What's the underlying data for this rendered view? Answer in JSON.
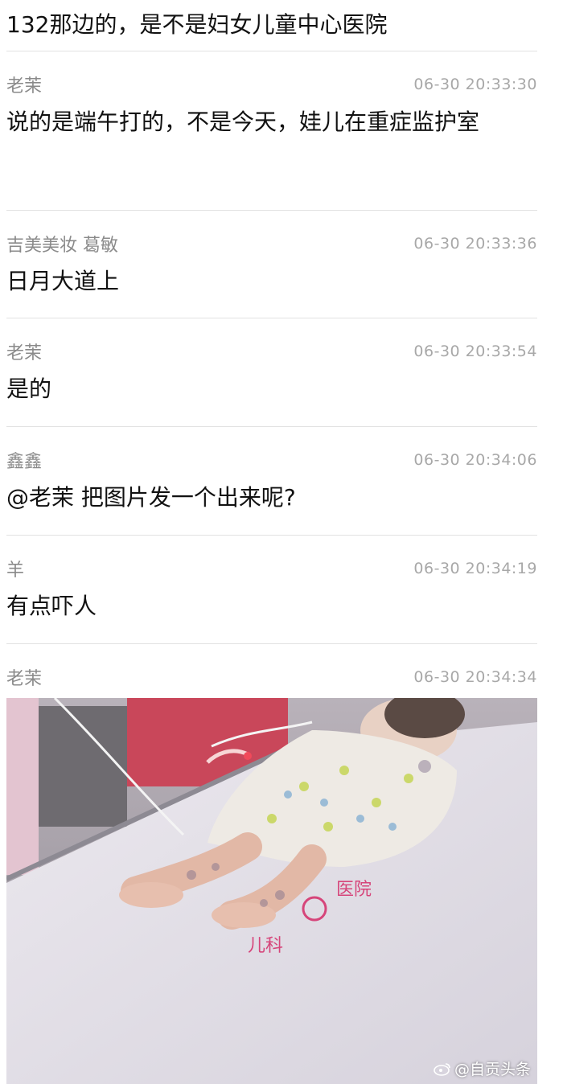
{
  "top_message": "132那边的，是不是妇女儿童中心医院",
  "messages": [
    {
      "sender": "老茉",
      "time": "06-30 20:33:30",
      "content": "说的是端午打的，不是今天，娃儿在重症监护室"
    },
    {
      "sender": "吉美美妆 葛敏",
      "time": "06-30 20:33:36",
      "content": "日月大道上"
    },
    {
      "sender": "老茉",
      "time": "06-30 20:33:54",
      "content": "是的"
    },
    {
      "sender": "鑫鑫",
      "time": "06-30 20:34:06",
      "content": "@老茉 把图片发一个出来呢?"
    },
    {
      "sender": "羊",
      "time": "06-30 20:34:19",
      "content": "有点吓人"
    },
    {
      "sender": "老茉",
      "time": "06-30 20:34:34",
      "content": ""
    }
  ],
  "photo": {
    "watermark": "@自贡头条",
    "sheet_text": [
      "医院",
      "儿科"
    ],
    "watermark_icon": "weibo-icon"
  },
  "colors": {
    "sender": "#8a8a8a",
    "time": "#a8a8a8",
    "divider": "#e2e2e2"
  }
}
